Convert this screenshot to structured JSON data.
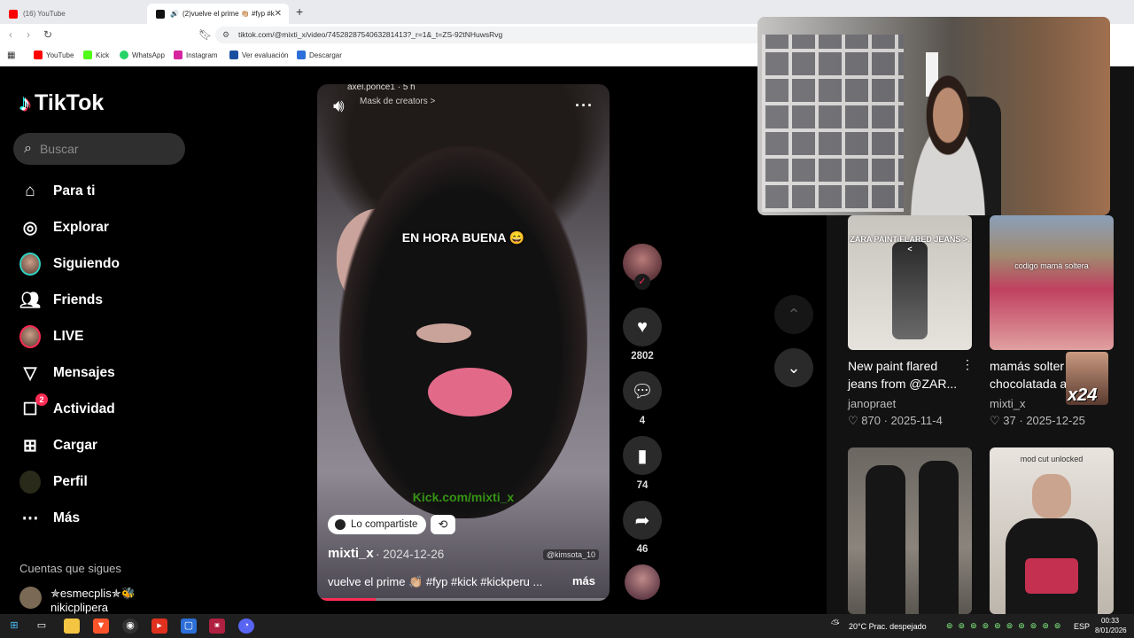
{
  "browser": {
    "tabs": [
      {
        "label": "(16) YouTube"
      },
      {
        "label": "(2)vuelve el prime 👏🏼 #fyp #k"
      }
    ],
    "url": "tiktok.com/@mixti_x/video/7452828754063281413?_r=1&_t=ZS-92tNHuwsRvg",
    "bookmarks": [
      "YouTube",
      "Kick",
      "WhatsApp",
      "Instagram",
      "Ver evaluación",
      "Descargar"
    ]
  },
  "sidebar": {
    "logo": "TikTok",
    "search_placeholder": "Buscar",
    "items": [
      {
        "label": "Para ti",
        "icon": "home-icon"
      },
      {
        "label": "Explorar",
        "icon": "compass-icon"
      },
      {
        "label": "Siguiendo",
        "icon": "avatar-icon"
      },
      {
        "label": "Friends",
        "icon": "friends-icon"
      },
      {
        "label": "LIVE",
        "icon": "live-icon"
      },
      {
        "label": "Mensajes",
        "icon": "send-icon"
      },
      {
        "label": "Actividad",
        "icon": "inbox-icon",
        "badge": "2"
      },
      {
        "label": "Cargar",
        "icon": "plus-square-icon"
      },
      {
        "label": "Perfil",
        "icon": "profile-icon"
      },
      {
        "label": "Más",
        "icon": "more-icon"
      }
    ],
    "following_title": "Cuentas que sigues",
    "following_account": {
      "display": "✯esmecplis✯🐝",
      "handle": "nikicplipera"
    }
  },
  "video": {
    "header_user": "axel.ponce1 · 5 h",
    "header_sub": "Mask de creators >",
    "overlay_text": "EN HORA BUENA 😄",
    "watermark": "Kick.com/mixti_x",
    "shared_label": "Lo compartiste",
    "author": "mixti_x",
    "date": "· 2024-12-26",
    "credit": "@kimsota_10",
    "description": "vuelve el prime 👏🏼 #fyp #kick #kickperu ...",
    "more_label": "más",
    "progress": 0.2
  },
  "actions": {
    "likes": "2802",
    "comments": "4",
    "saves": "74",
    "shares": "46"
  },
  "recommended": [
    {
      "title": "New paint flared jeans from @ZAR...",
      "thumb_caption": "ZARA PAINT FLARED JEANS >.<",
      "user": "janopraet",
      "likes": "870",
      "date": "2025-11-4"
    },
    {
      "title": "mamás solter chocolatada a",
      "thumb_caption": "codigo mamá soltera",
      "user": "mixti_x",
      "likes": "37",
      "date": "2025-12-25"
    },
    {
      "title": "",
      "thumb_caption": "",
      "user": "",
      "likes": "",
      "date": ""
    },
    {
      "title": "",
      "thumb_caption": "mod cut unlocked",
      "user": "",
      "likes": "",
      "date": ""
    }
  ],
  "overlay_badge": "x24",
  "taskbar": {
    "weather": "20°C  Prac. despejado",
    "lang": "ESP",
    "time": "00:33",
    "date": "8/01/2026"
  },
  "colors": {
    "accent": "#fe2c55",
    "kick_green": "#53fc18",
    "background": "#000000"
  }
}
